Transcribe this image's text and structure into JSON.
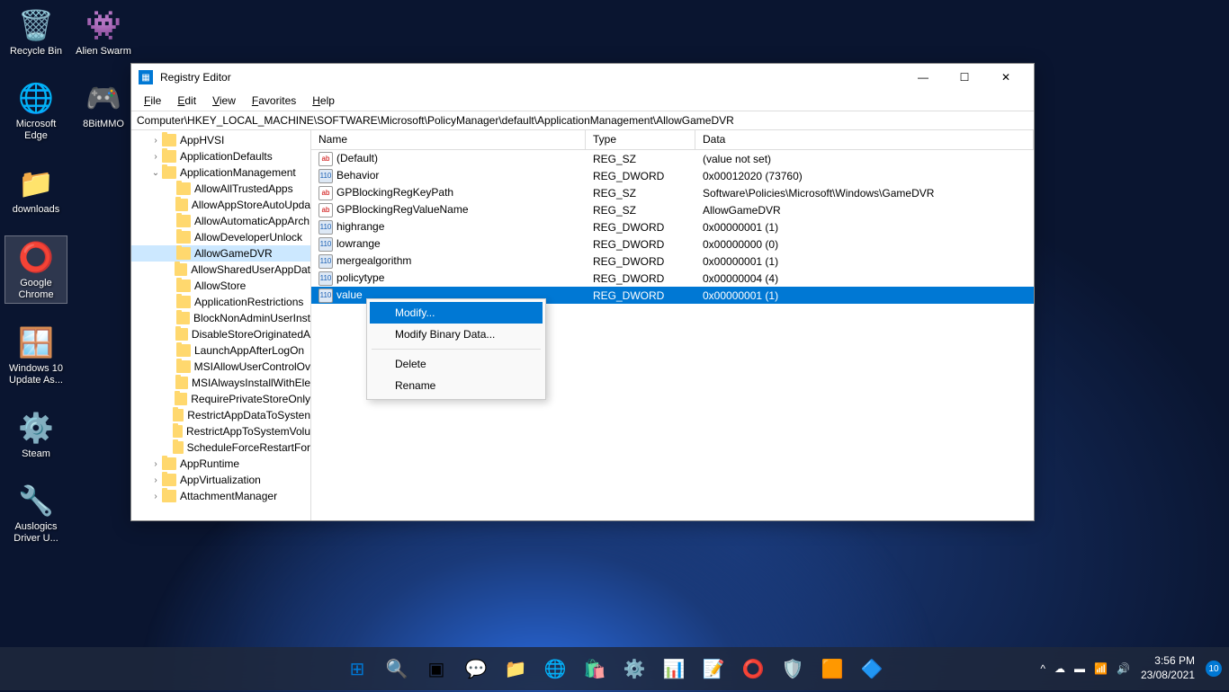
{
  "desktop": {
    "icons_col1": [
      {
        "name": "recycle-bin",
        "label": "Recycle Bin",
        "glyph": "🗑️"
      },
      {
        "name": "edge",
        "label": "Microsoft Edge",
        "glyph": "🌐"
      },
      {
        "name": "downloads",
        "label": "downloads",
        "glyph": "📁"
      },
      {
        "name": "chrome",
        "label": "Google Chrome",
        "glyph": "⭕",
        "selected": true
      },
      {
        "name": "win10-update",
        "label": "Windows 10 Update As...",
        "glyph": "🪟"
      },
      {
        "name": "steam",
        "label": "Steam",
        "glyph": "⚙️"
      },
      {
        "name": "auslogics",
        "label": "Auslogics Driver U...",
        "glyph": "🔧"
      }
    ],
    "icons_col2": [
      {
        "name": "alien-swarm",
        "label": "Alien Swarm",
        "glyph": "👾"
      },
      {
        "name": "8bitmmo",
        "label": "8BitMMO",
        "glyph": "🎮"
      }
    ]
  },
  "window": {
    "title": "Registry Editor",
    "menu": [
      "File",
      "Edit",
      "View",
      "Favorites",
      "Help"
    ],
    "address": "Computer\\HKEY_LOCAL_MACHINE\\SOFTWARE\\Microsoft\\PolicyManager\\default\\ApplicationManagement\\AllowGameDVR",
    "columns": {
      "name": "Name",
      "type": "Type",
      "data": "Data"
    },
    "tree": [
      {
        "label": "AppHVSI",
        "indent": 1,
        "exp": ">"
      },
      {
        "label": "ApplicationDefaults",
        "indent": 1,
        "exp": ">"
      },
      {
        "label": "ApplicationManagement",
        "indent": 1,
        "exp": "v"
      },
      {
        "label": "AllowAllTrustedApps",
        "indent": 2,
        "exp": ""
      },
      {
        "label": "AllowAppStoreAutoUpda",
        "indent": 2,
        "exp": ""
      },
      {
        "label": "AllowAutomaticAppArch",
        "indent": 2,
        "exp": ""
      },
      {
        "label": "AllowDeveloperUnlock",
        "indent": 2,
        "exp": ""
      },
      {
        "label": "AllowGameDVR",
        "indent": 2,
        "exp": "",
        "selected": true
      },
      {
        "label": "AllowSharedUserAppDat",
        "indent": 2,
        "exp": ""
      },
      {
        "label": "AllowStore",
        "indent": 2,
        "exp": ""
      },
      {
        "label": "ApplicationRestrictions",
        "indent": 2,
        "exp": ""
      },
      {
        "label": "BlockNonAdminUserInst",
        "indent": 2,
        "exp": ""
      },
      {
        "label": "DisableStoreOriginatedA",
        "indent": 2,
        "exp": ""
      },
      {
        "label": "LaunchAppAfterLogOn",
        "indent": 2,
        "exp": ""
      },
      {
        "label": "MSIAllowUserControlOv",
        "indent": 2,
        "exp": ""
      },
      {
        "label": "MSIAlwaysInstallWithEle",
        "indent": 2,
        "exp": ""
      },
      {
        "label": "RequirePrivateStoreOnly",
        "indent": 2,
        "exp": ""
      },
      {
        "label": "RestrictAppDataToSysten",
        "indent": 2,
        "exp": ""
      },
      {
        "label": "RestrictAppToSystemVolu",
        "indent": 2,
        "exp": ""
      },
      {
        "label": "ScheduleForceRestartFor",
        "indent": 2,
        "exp": ""
      },
      {
        "label": "AppRuntime",
        "indent": 1,
        "exp": ">"
      },
      {
        "label": "AppVirtualization",
        "indent": 1,
        "exp": ">"
      },
      {
        "label": "AttachmentManager",
        "indent": 1,
        "exp": ">"
      }
    ],
    "values": [
      {
        "name": "(Default)",
        "type": "REG_SZ",
        "data": "(value not set)",
        "icon": "sz"
      },
      {
        "name": "Behavior",
        "type": "REG_DWORD",
        "data": "0x00012020 (73760)",
        "icon": "dw"
      },
      {
        "name": "GPBlockingRegKeyPath",
        "type": "REG_SZ",
        "data": "Software\\Policies\\Microsoft\\Windows\\GameDVR",
        "icon": "sz"
      },
      {
        "name": "GPBlockingRegValueName",
        "type": "REG_SZ",
        "data": "AllowGameDVR",
        "icon": "sz"
      },
      {
        "name": "highrange",
        "type": "REG_DWORD",
        "data": "0x00000001 (1)",
        "icon": "dw"
      },
      {
        "name": "lowrange",
        "type": "REG_DWORD",
        "data": "0x00000000 (0)",
        "icon": "dw"
      },
      {
        "name": "mergealgorithm",
        "type": "REG_DWORD",
        "data": "0x00000001 (1)",
        "icon": "dw"
      },
      {
        "name": "policytype",
        "type": "REG_DWORD",
        "data": "0x00000004 (4)",
        "icon": "dw"
      },
      {
        "name": "value",
        "type": "REG_DWORD",
        "data": "0x00000001 (1)",
        "icon": "dw",
        "selected": true
      }
    ]
  },
  "context_menu": {
    "items": [
      {
        "label": "Modify...",
        "highlighted": true
      },
      {
        "label": "Modify Binary Data..."
      },
      {
        "sep": true
      },
      {
        "label": "Delete"
      },
      {
        "label": "Rename"
      }
    ]
  },
  "taskbar": {
    "center_items": [
      {
        "name": "start",
        "glyph": "⊞",
        "color": "#0078d4"
      },
      {
        "name": "search",
        "glyph": "🔍"
      },
      {
        "name": "taskview",
        "glyph": "▣"
      },
      {
        "name": "chat",
        "glyph": "💬"
      },
      {
        "name": "explorer",
        "glyph": "📁"
      },
      {
        "name": "edge",
        "glyph": "🌐"
      },
      {
        "name": "store",
        "glyph": "🛍️"
      },
      {
        "name": "settings",
        "glyph": "⚙️"
      },
      {
        "name": "app1",
        "glyph": "📊"
      },
      {
        "name": "word",
        "glyph": "📝"
      },
      {
        "name": "chrome",
        "glyph": "⭕"
      },
      {
        "name": "security",
        "glyph": "🛡️"
      },
      {
        "name": "app2",
        "glyph": "🟧"
      },
      {
        "name": "regedit",
        "glyph": "🔷"
      }
    ],
    "tray": {
      "chevron": "^",
      "time": "3:56 PM",
      "date": "23/08/2021",
      "notif_count": "10"
    }
  }
}
